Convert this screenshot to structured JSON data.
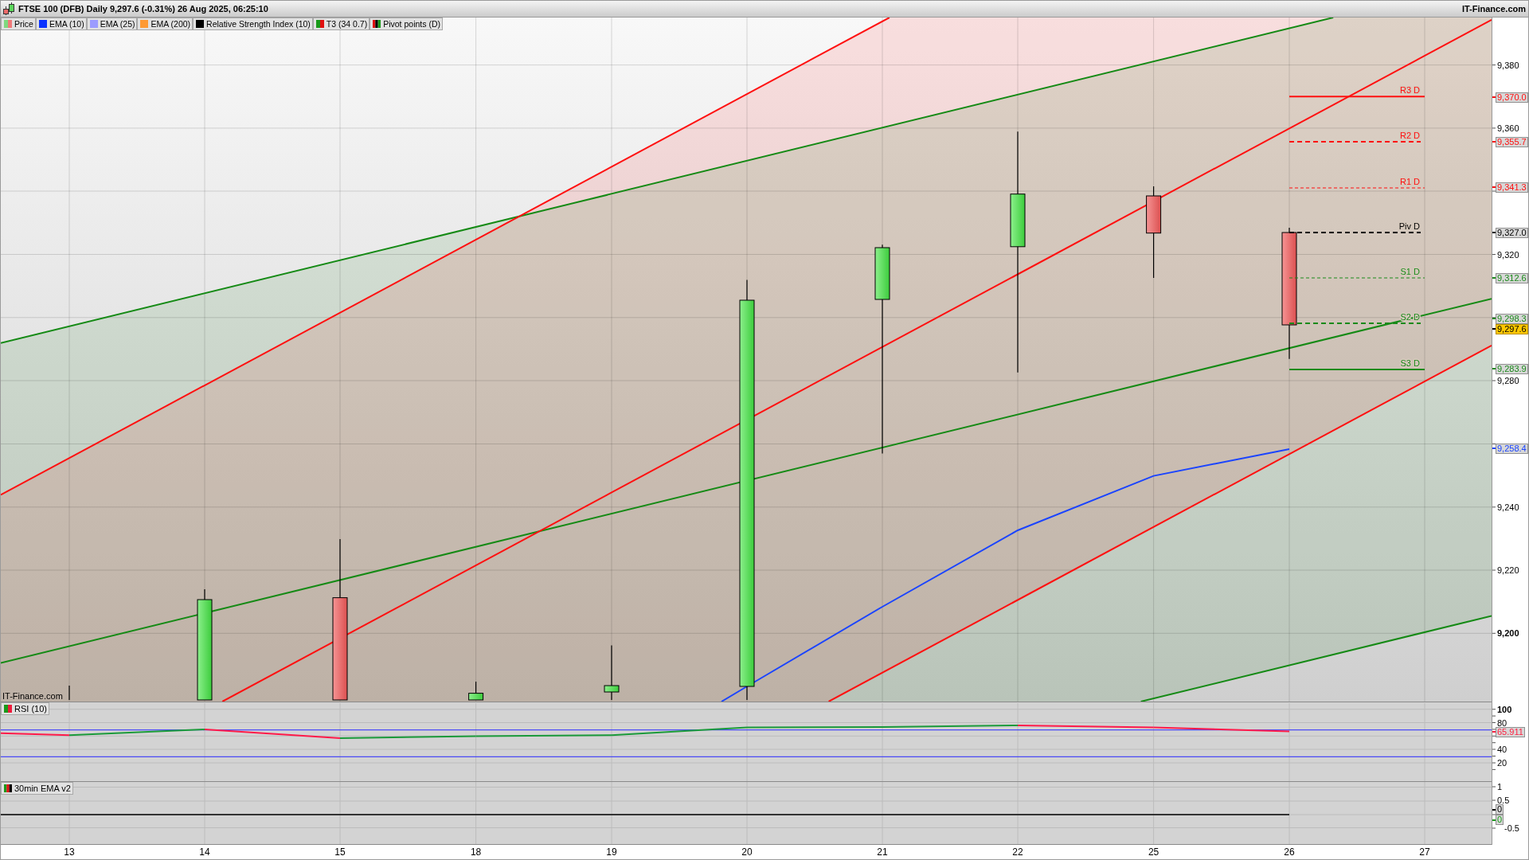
{
  "title_bar": {
    "title": "FTSE 100 (DFB) Daily 9,297.6 (-0.31%) 26 Aug 2025, 06:25:10",
    "brand": "IT-Finance.com"
  },
  "legend": [
    {
      "label": "Price",
      "swatch": [
        {
          "color": "#7ed87e"
        },
        {
          "color": "#f07a7a"
        }
      ]
    },
    {
      "label": "EMA (10)",
      "swatch": [
        {
          "color": "#0a32ff"
        }
      ]
    },
    {
      "label": "EMA (25)",
      "swatch": [
        {
          "color": "#9c9cff"
        }
      ]
    },
    {
      "label": "EMA (200)",
      "swatch": [
        {
          "color": "#ff9a33"
        }
      ]
    },
    {
      "label": "Relative Strength Index (10)",
      "swatch": [
        {
          "color": "#000000"
        }
      ]
    },
    {
      "label": "T3 (34 0.7)",
      "swatch": [
        {
          "color": "#1a9a1a"
        },
        {
          "color": "#e01010"
        }
      ]
    },
    {
      "label": "Pivot points (D)",
      "swatch": [
        {
          "color": "#e01010"
        },
        {
          "color": "#000000"
        },
        {
          "color": "#1a9a1a"
        }
      ]
    }
  ],
  "price_panel": {
    "chart_credit": "IT-Finance.com",
    "axis_ticks": [
      {
        "label": "9,380",
        "major": false
      },
      {
        "label": "9,360",
        "major": false
      },
      {
        "label": "9,320",
        "major": false
      },
      {
        "label": "9,280",
        "major": false
      },
      {
        "label": "9,240",
        "major": false
      },
      {
        "label": "9,220",
        "major": false
      },
      {
        "label": "9,200",
        "major": true
      }
    ],
    "pivots": [
      {
        "label": "R3 D",
        "value": "9,370.0",
        "color": "#ff1010",
        "kind": "solid"
      },
      {
        "label": "R2 D",
        "value": "9,355.7",
        "color": "#ff1010",
        "kind": "dashed"
      },
      {
        "label": "R1 D",
        "value": "9,341.3",
        "color": "#ff1010",
        "kind": "fine_dashed"
      },
      {
        "label": "Piv D",
        "value": "9,327.0",
        "color": "#000000",
        "kind": "dashed"
      },
      {
        "label": "S1 D",
        "value": "9,312.6",
        "color": "#1a8a1a",
        "kind": "fine_dashed"
      },
      {
        "label": "S2 D",
        "value": "9,298.3",
        "color": "#1a8a1a",
        "kind": "dashed"
      },
      {
        "label": "S3 D",
        "value": "9,283.9",
        "color": "#1a8a1a",
        "kind": "solid"
      }
    ],
    "axis_tags": [
      {
        "text": "9,297.6",
        "kind": "last",
        "color": "#000000"
      },
      {
        "text": "9,258.4",
        "kind": "line",
        "color": "#1a44ff"
      }
    ]
  },
  "rsi_panel": {
    "label": "RSI (10)",
    "swatch": [
      {
        "color": "#1a9a1a"
      },
      {
        "color": "#ee1c3c"
      }
    ],
    "axis_ticks": [
      {
        "label": "100",
        "major": true
      },
      {
        "label": "80",
        "major": false
      },
      {
        "label": "40",
        "major": false
      },
      {
        "label": "20",
        "major": false
      }
    ],
    "axis_tags": [
      {
        "text": "65.911",
        "color": "#ff2040"
      }
    ]
  },
  "ema_panel": {
    "label": "30min EMA v2",
    "swatch": [
      {
        "color": "#1a9a1a"
      },
      {
        "color": "#e01010"
      },
      {
        "color": "#000000"
      }
    ],
    "axis_ticks": [
      {
        "label": "1",
        "major": false
      },
      {
        "label": "0.5",
        "major": false
      },
      {
        "label": "-0.5",
        "major": false
      }
    ],
    "axis_tags": [
      {
        "text": "0",
        "color": "#000000"
      },
      {
        "text": "0",
        "color": "#1a9a1a"
      }
    ]
  },
  "date_axis": [
    "13",
    "14",
    "15",
    "18",
    "19",
    "20",
    "21",
    "22",
    "25",
    "26",
    "27"
  ]
}
